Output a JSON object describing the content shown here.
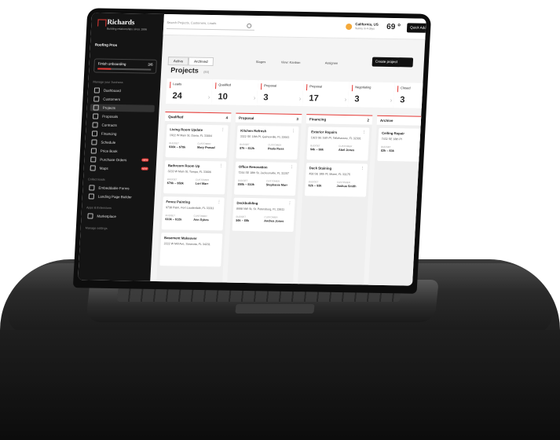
{
  "brand": {
    "name": "Richards",
    "tagline": "Building relationships since 1996"
  },
  "sidebar": {
    "org": "Roofing Pros",
    "onboarding": {
      "label": "Finish onboarding",
      "count": "3/6",
      "progress": 0.25
    },
    "section_manage": "Manage your business",
    "items": [
      {
        "label": "Dashboard"
      },
      {
        "label": "Customers"
      },
      {
        "label": "Projects"
      },
      {
        "label": "Proposals"
      },
      {
        "label": "Contracts"
      },
      {
        "label": "Financing"
      },
      {
        "label": "Schedule"
      },
      {
        "label": "Price Book"
      },
      {
        "label": "Purchase Orders",
        "badge": "NEW"
      },
      {
        "label": "Maps",
        "badge": "NEW"
      }
    ],
    "section_leads": "Collect leads",
    "lead_items": [
      {
        "label": "Embeddable Forms"
      },
      {
        "label": "Landing Page Builder"
      }
    ],
    "section_apps": "Apps & Extensions",
    "app_items": [
      {
        "label": "Marketplace"
      }
    ],
    "section_settings": "Manage settings"
  },
  "topbar": {
    "search_placeholder": "Search Projects, Customers, Leads",
    "weather_location": "California, US",
    "weather_sub": "Sunny in 4 days",
    "temperature": "69 °",
    "quick_add": "Quick Add"
  },
  "main": {
    "tabs": [
      {
        "label": "Active"
      },
      {
        "label": "Archived"
      }
    ],
    "title": "Projects",
    "count": "(84)",
    "toolbar": {
      "stages": "Stages",
      "view": "View: Kanban",
      "assignee": "Assignee",
      "create": "Create project"
    },
    "stages": [
      {
        "name": "Leads",
        "count": "24"
      },
      {
        "name": "Qualified",
        "count": "10"
      },
      {
        "name": "Proposal",
        "count": "3"
      },
      {
        "name": "Proposal",
        "count": "17"
      },
      {
        "name": "Negotiating",
        "count": "3"
      },
      {
        "name": "Closed",
        "count": "3"
      }
    ],
    "columns": [
      {
        "name": "Qualified",
        "count": "4",
        "cards": [
          {
            "title": "Living Room Update",
            "addr": "1922 W Main St, Dania, FL 33004",
            "budget": "$10k – $70k",
            "customer": "Mary Prasad"
          },
          {
            "title": "Bathroom Room Up",
            "addr": "3233 W Main St, Tampa, FL 33606",
            "budget": "$70k – $50k",
            "customer": "Lori Marr"
          },
          {
            "title": "Fence Painting",
            "addr": "9738 Palm, Fort Lauderdale, FL 33311",
            "budget": "$10k – $12k",
            "customer": "Ann Sykes"
          },
          {
            "title": "Basement Makeover",
            "addr": "2222 W Mill Ave, Sarasota, FL 34231",
            "budget": "",
            "customer": ""
          }
        ]
      },
      {
        "name": "Proposal",
        "count": "3",
        "cards": [
          {
            "title": "Kitchen Refresh",
            "addr": "3322 SE 18th Pl, Gainesville, FL 32641",
            "budget": "$7k – $12k",
            "customer": "Paula Ross"
          },
          {
            "title": "Office Renovation",
            "addr": "7244 SE 18th St, Jacksonville, FL 32207",
            "budget": "$50k – $10k",
            "customer": "Stephanie Marr"
          },
          {
            "title": "Deckbuilding",
            "addr": "8998 NW St, St. Petersburg, FL 33611",
            "budget": "$4k – $8k",
            "customer": "Andrea Jones"
          }
        ]
      },
      {
        "name": "Financing",
        "count": "2",
        "cards": [
          {
            "title": "Exterior Repairs",
            "addr": "1923 SE 16th Pl, Tallahassee, FL 32301",
            "budget": "$4k – $6k",
            "customer": "Abel Jones"
          },
          {
            "title": "Deck Staining",
            "addr": "456 SE 18th Pl, Miami, FL 33175",
            "budget": "$2k – $3k",
            "customer": "Joshua Smith"
          }
        ]
      },
      {
        "name": "Archive",
        "count": "",
        "cards": [
          {
            "title": "Ceiling Repair",
            "addr": "7432 SE 18th Pl",
            "budget": "$2k – $3k",
            "customer": ""
          }
        ]
      }
    ]
  }
}
